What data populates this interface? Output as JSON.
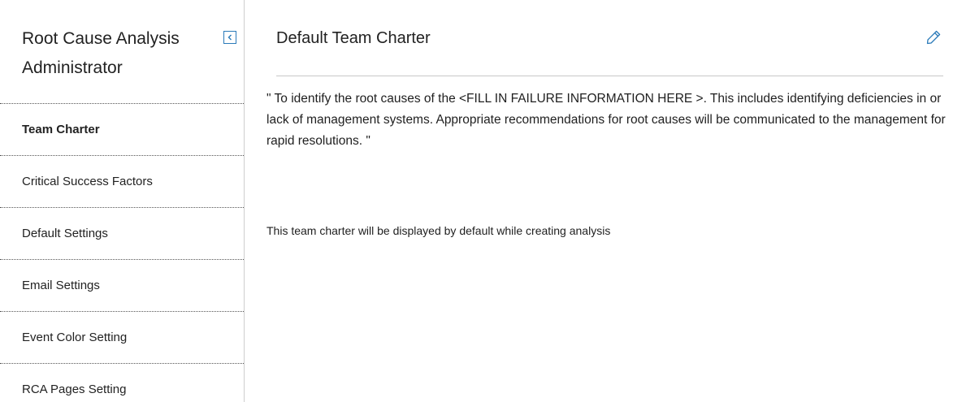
{
  "sidebar": {
    "title_line1": "Root Cause Analysis",
    "title_line2": "Administrator",
    "collapse_icon": "chevron-left-icon",
    "items": [
      {
        "label": "Team Charter",
        "active": true
      },
      {
        "label": "Critical Success Factors",
        "active": false
      },
      {
        "label": "Default Settings",
        "active": false
      },
      {
        "label": "Email Settings",
        "active": false
      },
      {
        "label": "Event Color Setting",
        "active": false
      },
      {
        "label": "RCA Pages Setting",
        "active": false
      }
    ]
  },
  "main": {
    "title": "Default Team Charter",
    "edit_icon": "pencil-icon",
    "charter_text": "\" To identify the root causes of the <FILL IN FAILURE INFORMATION HERE >. This includes identifying deficiencies in or lack of management systems. Appropriate recommendations for root causes will be communicated to the management for rapid resolutions. \"",
    "note": "This team charter will be displayed by default while creating analysis"
  },
  "colors": {
    "accent": "#2a7ab9",
    "divider": "#c8c8c8",
    "text": "#1f1f1f"
  }
}
